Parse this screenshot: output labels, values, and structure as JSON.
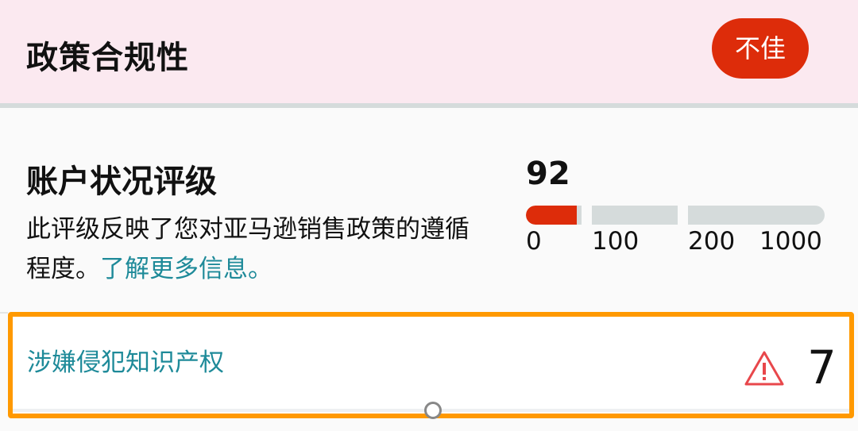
{
  "header": {
    "title": "政策合规性",
    "status_badge": "不佳",
    "status_color": "#dd2c0a",
    "background_color": "#fbe9f0"
  },
  "account_health": {
    "title": "账户状况评级",
    "description": "此评级反映了您对亚马逊销售政策的遵循程度。",
    "learn_more_link": "了解更多信息。",
    "score": "92",
    "score_value": 92,
    "scale_ticks": [
      "0",
      "100",
      "200",
      "1000"
    ],
    "bar_fill_fraction_of_first_segment": 0.92,
    "fill_color": "#dd2c0a",
    "track_color": "#d5dbdb"
  },
  "issues": [
    {
      "label": "涉嫌侵犯知识产权",
      "icon": "warning-triangle-icon",
      "count": "7",
      "highlight_color": "#ff9900"
    }
  ],
  "colors": {
    "link": "#1e8a99",
    "text": "#111111"
  }
}
